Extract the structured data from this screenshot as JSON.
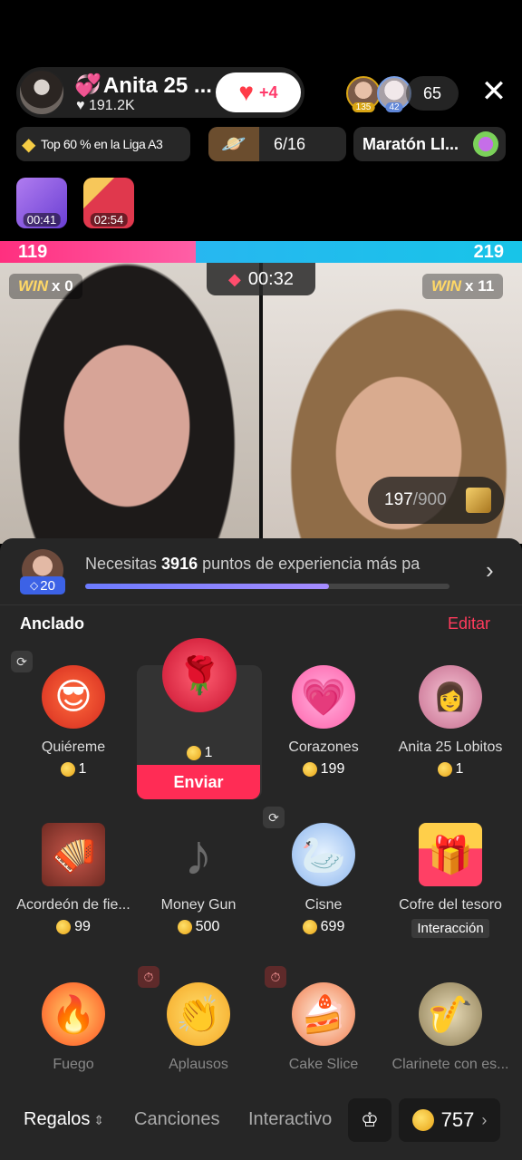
{
  "host": {
    "name": "Anita 25 ...",
    "likes": "191.2K",
    "follow_plus": "+4"
  },
  "viewers": [
    {
      "count": "135"
    },
    {
      "count": "42"
    }
  ],
  "viewer_total": "65",
  "chips": {
    "league": "Top 60 % en la Liga A3",
    "progress": "6/16",
    "marathon": "Maratón LI..."
  },
  "boxes": [
    {
      "time": "00:41"
    },
    {
      "time": "02:54"
    }
  ],
  "battle": {
    "left_score": "119",
    "right_score": "219",
    "timer": "00:32",
    "left_win_label": "WIN",
    "left_win_count": "x 0",
    "right_win_label": "WIN",
    "right_win_count": "x 11",
    "goal_current": "197",
    "goal_total": "/900"
  },
  "level": {
    "badge": "20",
    "text_pre": "Necesitas ",
    "text_points": "3916",
    "text_post": " puntos de experiencia más pa",
    "progress": 0.67
  },
  "pinned": {
    "title": "Anclado",
    "edit": "Editar"
  },
  "gifts": [
    {
      "name": "Quiéreme",
      "price": "1",
      "icon": "heart-face-icon"
    },
    {
      "name": "",
      "price": "1",
      "icon": "rose-icon",
      "send": "Enviar"
    },
    {
      "name": "Corazones",
      "price": "199",
      "icon": "hearts-icon"
    },
    {
      "name": "Anita 25 Lobitos",
      "price": "1",
      "icon": "anita-sticker-icon"
    },
    {
      "name": "Acordeón de fie...",
      "price": "99",
      "icon": "accordion-icon"
    },
    {
      "name": "Money Gun",
      "price": "500",
      "icon": "tiktok-logo-icon"
    },
    {
      "name": "Cisne",
      "price": "699",
      "icon": "swan-icon"
    },
    {
      "name": "Cofre del tesoro",
      "price": "Interacción",
      "icon": "treasure-chest-icon"
    },
    {
      "name": "Fuego",
      "icon": "fire-icon"
    },
    {
      "name": "Aplausos",
      "icon": "clapping-hands-icon"
    },
    {
      "name": "Cake Slice",
      "icon": "cake-icon"
    },
    {
      "name": "Clarinete con es...",
      "icon": "clarinet-icon"
    }
  ],
  "tabs": {
    "gifts": "Regalos",
    "songs": "Canciones",
    "interactive": "Interactivo"
  },
  "balance": "757"
}
